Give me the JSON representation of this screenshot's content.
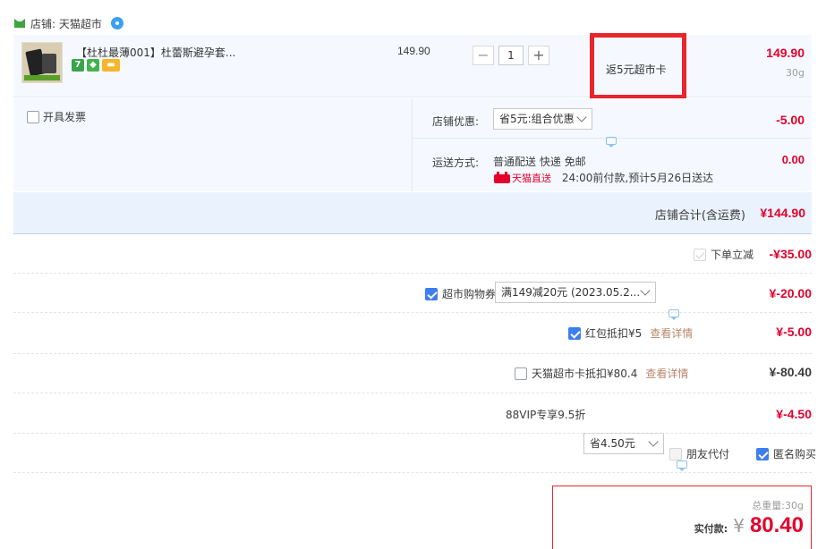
{
  "shop": {
    "label": "店铺: 天猫超市"
  },
  "item": {
    "title": "【杜杜最薄001】杜蕾斯避孕套...",
    "badges": [
      "7"
    ],
    "unit_price": "149.90",
    "qty_minus": "−",
    "quantity": "1",
    "qty_plus": "+",
    "promo": "返5元超市卡",
    "total": "149.90",
    "weight": "30g"
  },
  "invoice": {
    "label": "开具发票"
  },
  "shop_discount": {
    "label": "店铺优惠:",
    "selected": "省5元:组合优惠",
    "amount": "-5.00"
  },
  "shipping": {
    "label": "运送方式:",
    "method": "普通配送 快递 免邮",
    "tmall": "天猫直送",
    "delivery": "24:00前付款,预计5月26日送达",
    "amount": "0.00"
  },
  "shop_total": {
    "label": "店铺合计(含运费)",
    "amount": "¥144.90"
  },
  "discounts": {
    "order_cut": {
      "label": "下单立减",
      "amount": "-¥35.00"
    },
    "coupon": {
      "label": "超市购物券",
      "selected": "满149减20元 (2023.05.2...",
      "amount": "¥-20.00"
    },
    "redpacket": {
      "label": "红包抵扣¥5",
      "link": "查看详情",
      "amount": "¥-5.00"
    },
    "card": {
      "label": "天猫超市卡抵扣¥80.4",
      "link": "查看详情",
      "amount": "¥-80.40"
    },
    "vip": {
      "label": "88VIP专享9.5折",
      "selected": "省4.50元",
      "amount": "¥-4.50"
    }
  },
  "options": {
    "friend_pay": "朋友代付",
    "anonymous": "匿名购买"
  },
  "summary": {
    "weight_label": "总重量:",
    "weight": "30g",
    "pay_label": "实付款:",
    "currency": "¥",
    "amount": "80.40"
  },
  "colors": {
    "price_red": "#e4002b",
    "promo_border": "#e8262c",
    "accent_blue": "#3d7ef0",
    "row_bg": "#f5f9ff"
  }
}
